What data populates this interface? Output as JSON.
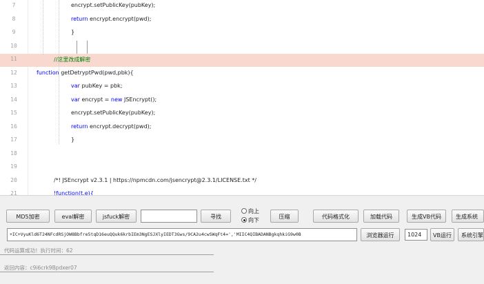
{
  "editor": {
    "lines": [
      {
        "num": "7",
        "indent": 2,
        "tokens": [
          {
            "t": "encrypt.setPublicKey(pubKey);",
            "c": ""
          }
        ]
      },
      {
        "num": "8",
        "indent": 2,
        "tokens": [
          {
            "t": "return",
            "c": "kw"
          },
          {
            "t": " encrypt.encrypt(pwd);",
            "c": ""
          }
        ]
      },
      {
        "num": "9",
        "indent": 2,
        "tokens": [
          {
            "t": "}",
            "c": ""
          }
        ]
      },
      {
        "num": "10",
        "indent": 0,
        "tokens": []
      },
      {
        "num": "11",
        "indent": 1,
        "highlight": true,
        "tokens": [
          {
            "t": "//这里改成解密",
            "c": "cm"
          }
        ]
      },
      {
        "num": "12",
        "indent": 0,
        "tokens": [
          {
            "t": "function",
            "c": "kw"
          },
          {
            "t": " getDetryptPwd(pwd,pbk){",
            "c": ""
          }
        ]
      },
      {
        "num": "13",
        "indent": 2,
        "tokens": [
          {
            "t": "var",
            "c": "kw"
          },
          {
            "t": " pubKey = pbk;",
            "c": ""
          }
        ]
      },
      {
        "num": "14",
        "indent": 2,
        "tokens": [
          {
            "t": "var",
            "c": "kw"
          },
          {
            "t": " encrypt = ",
            "c": ""
          },
          {
            "t": "new",
            "c": "kw"
          },
          {
            "t": " JSEncrypt();",
            "c": ""
          }
        ]
      },
      {
        "num": "15",
        "indent": 2,
        "tokens": [
          {
            "t": "encrypt.setPublicKey(pubKey);",
            "c": ""
          }
        ]
      },
      {
        "num": "16",
        "indent": 2,
        "tokens": [
          {
            "t": "return",
            "c": "kw"
          },
          {
            "t": " encrypt.decrypt(pwd);",
            "c": ""
          }
        ]
      },
      {
        "num": "17",
        "indent": 2,
        "tokens": [
          {
            "t": "}",
            "c": ""
          }
        ]
      },
      {
        "num": "18",
        "indent": 0,
        "tokens": []
      },
      {
        "num": "19",
        "indent": 0,
        "tokens": []
      },
      {
        "num": "20",
        "indent": 1,
        "tokens": [
          {
            "t": "/*! JSEncrypt v2.3.1 | https://npmcdn.com/jsencrypt@2.3.1/LICENSE.txt */",
            "c": ""
          }
        ]
      },
      {
        "num": "21",
        "indent": 1,
        "tokens": [
          {
            "t": "!function(t,e){",
            "c": "kw"
          }
        ]
      }
    ]
  },
  "toolbar": {
    "md5_label": "MD5加密",
    "eval_label": "eval解密",
    "jsfuck_label": "jsfuck解密",
    "search_value": "",
    "find_label": "寻找",
    "radio_up_label": "向上",
    "radio_down_label": "向下",
    "compress_label": "压缩",
    "format_label": "代码格式化",
    "load_label": "加载代码",
    "gen_vb_label": "生成VB代码",
    "gen_sys_label": "生成系统"
  },
  "row2": {
    "code_input_value": "+IC+VyuKld6T24NFcdRSjOW8Bbfre5tqD16euQQuk6krbIEm3NgESJXlyIEDT3Gws/9CA2u4cwSWqFt4=','MIIC4QIBADANBgkqhkiG9w0B",
    "browser_run_label": "浏览器运行",
    "timeout_value": "1024",
    "vb_run_label": "VB运行",
    "sys_ref_label": "系统引擎"
  },
  "status": {
    "success_text": "代码运算成功！执行时间：62",
    "result_text": "返回内容：c9i6crk9Bpdxer07"
  },
  "colors": {
    "highlight_line": "#f9d9cf",
    "keyword": "#0000ff",
    "comment": "#008000"
  }
}
